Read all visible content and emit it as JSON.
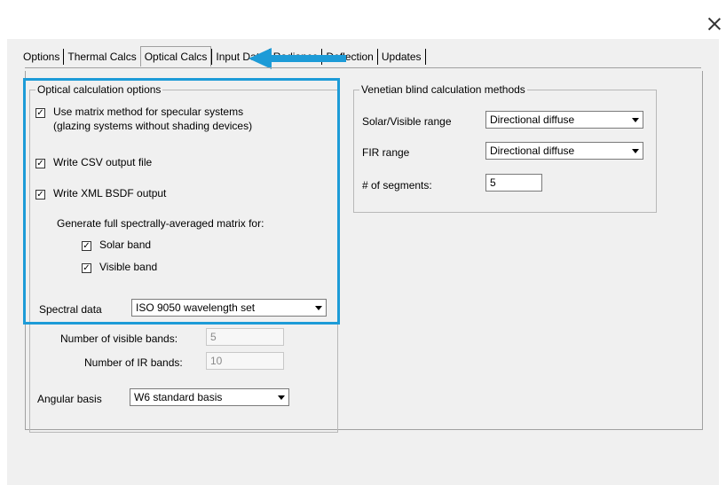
{
  "colors": {
    "accent_highlight": "#1d9bd7",
    "arrow": "#1d9bd7",
    "dialog_bg": "#f0f0f0"
  },
  "window": {
    "close_icon": "close-icon"
  },
  "tabs": [
    {
      "label": "Options"
    },
    {
      "label": "Thermal Calcs"
    },
    {
      "label": "Optical Calcs",
      "active": true
    },
    {
      "label": "Input Data"
    },
    {
      "label": "Radiance"
    },
    {
      "label": "Deflection"
    },
    {
      "label": "Updates"
    }
  ],
  "optical": {
    "title": "Optical calculation options",
    "matrix_method": {
      "label_line1": "Use matrix method for specular systems",
      "label_line2": "(glazing systems without shading devices)",
      "checked": true
    },
    "write_csv": {
      "label": "Write CSV output file",
      "checked": true
    },
    "write_xml": {
      "label": "Write XML BSDF output",
      "checked": true
    },
    "generate_label": "Generate full spectrally-averaged matrix for:",
    "solar_band": {
      "label": "Solar band",
      "checked": true
    },
    "visible_band": {
      "label": "Visible band",
      "checked": true
    },
    "spectral_data": {
      "label": "Spectral data",
      "value": "ISO 9050 wavelength set"
    },
    "num_visible_bands": {
      "label": "Number of visible bands:",
      "value": "5"
    },
    "num_ir_bands": {
      "label": "Number of IR bands:",
      "value": "10"
    },
    "angular_basis": {
      "label": "Angular basis",
      "value": "W6 standard basis"
    }
  },
  "venetian": {
    "title": "Venetian blind calculation methods",
    "solar_visible": {
      "label": "Solar/Visible range",
      "value": "Directional diffuse"
    },
    "fir": {
      "label": "FIR range",
      "value": "Directional diffuse"
    },
    "segments": {
      "label": "# of segments:",
      "value": "5"
    }
  }
}
